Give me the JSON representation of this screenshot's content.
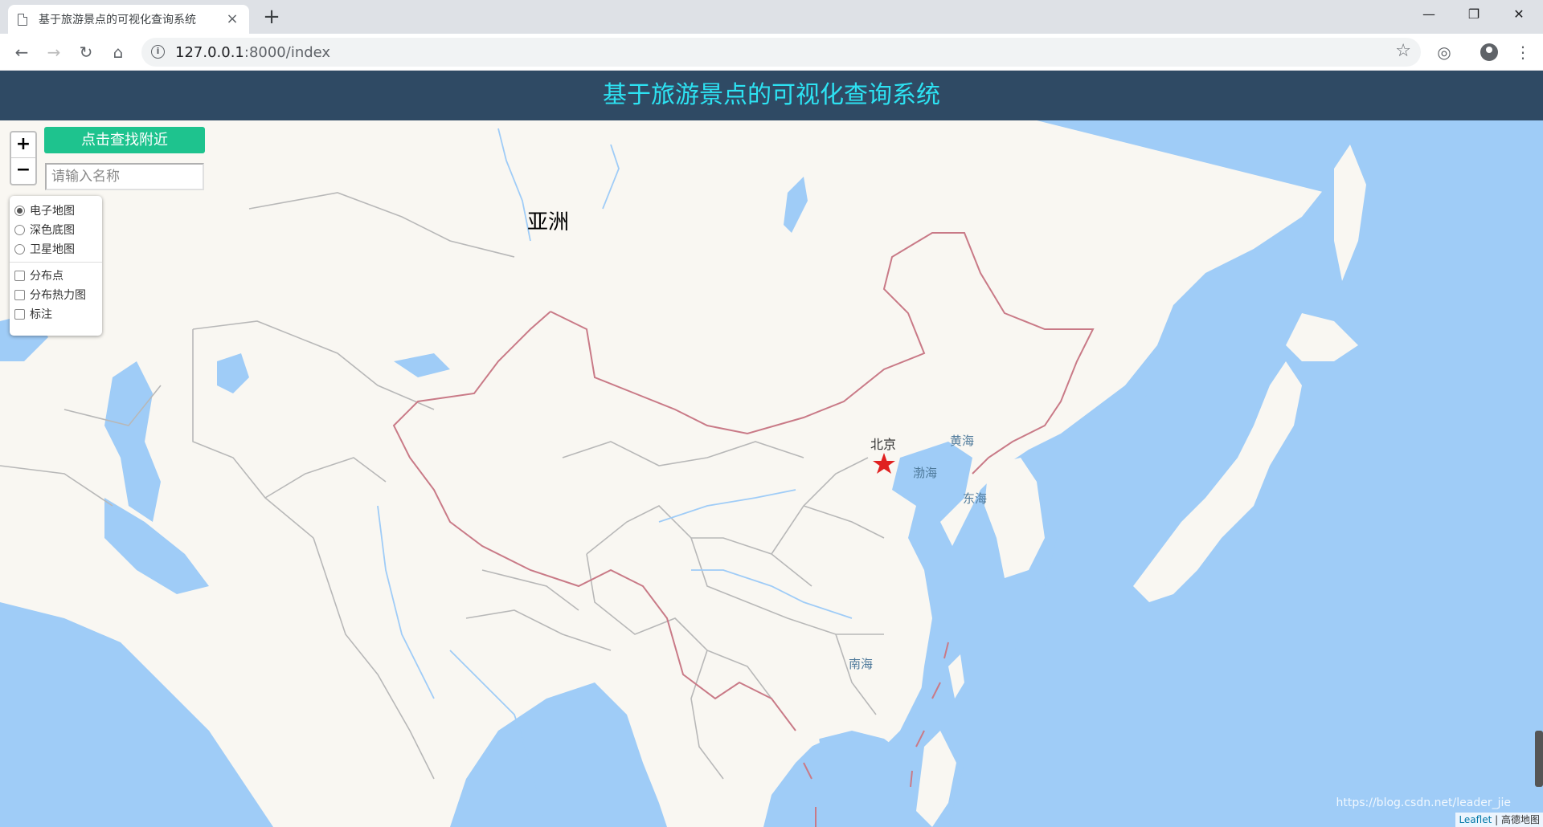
{
  "browser": {
    "tab_title": "基于旅游景点的可视化查询系统",
    "url_host": "127.0.0.1",
    "url_rest": ":8000/index"
  },
  "page": {
    "header_title": "基于旅游景点的可视化查询系统"
  },
  "controls": {
    "find_nearby_label": "点击查找附近",
    "search_placeholder": "请输入名称",
    "zoom_in": "+",
    "zoom_out": "−"
  },
  "layers": {
    "base_layers": [
      {
        "label": "电子地图",
        "selected": true
      },
      {
        "label": "深色底图",
        "selected": false
      },
      {
        "label": "卫星地图",
        "selected": false
      }
    ],
    "overlays": [
      {
        "label": "分布点",
        "checked": false
      },
      {
        "label": "分布热力图",
        "checked": false
      },
      {
        "label": "标注",
        "checked": false
      }
    ]
  },
  "map": {
    "continent_label": "亚洲",
    "city_label": "北京",
    "seas": [
      "渤海",
      "黄海",
      "东海",
      "南海"
    ],
    "colors": {
      "water": "#9fccf7",
      "land": "#f9f7f2",
      "border": "#c97a87",
      "marker": "#e02020"
    }
  },
  "footer": {
    "attribution_link": "Leaflet",
    "attribution_text": " | 高德地图",
    "watermark": "https://blog.csdn.net/leader_jie"
  }
}
